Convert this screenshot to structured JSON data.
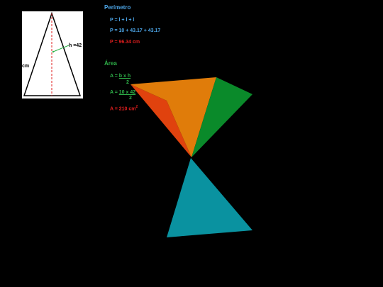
{
  "figure": {
    "height_label": "h =42",
    "side_label": "cm"
  },
  "perimeter": {
    "heading": "Perímetro",
    "formula": "P = l + l + l",
    "substitution": "P = 10 + 43.17 + 43.17",
    "result": "P = 96.34 cm"
  },
  "area": {
    "heading": "Área",
    "formula_prefix": "A = ",
    "formula_numerator": "b x h",
    "formula_denominator": "2",
    "substitution_prefix": "A = ",
    "substitution_numerator": "10 x 42",
    "substitution_denominator": "2",
    "result": "A = 210 cm",
    "result_unit_power": "2"
  },
  "colors": {
    "background": "#000000",
    "blue_text": "#4da6e8",
    "green_text": "#2fb34a",
    "red_text": "#e01e1e",
    "shape_orange": "#e07c0a",
    "shape_red": "#e0420e",
    "shape_green": "#0a8a2a",
    "shape_teal": "#0a92a0"
  }
}
